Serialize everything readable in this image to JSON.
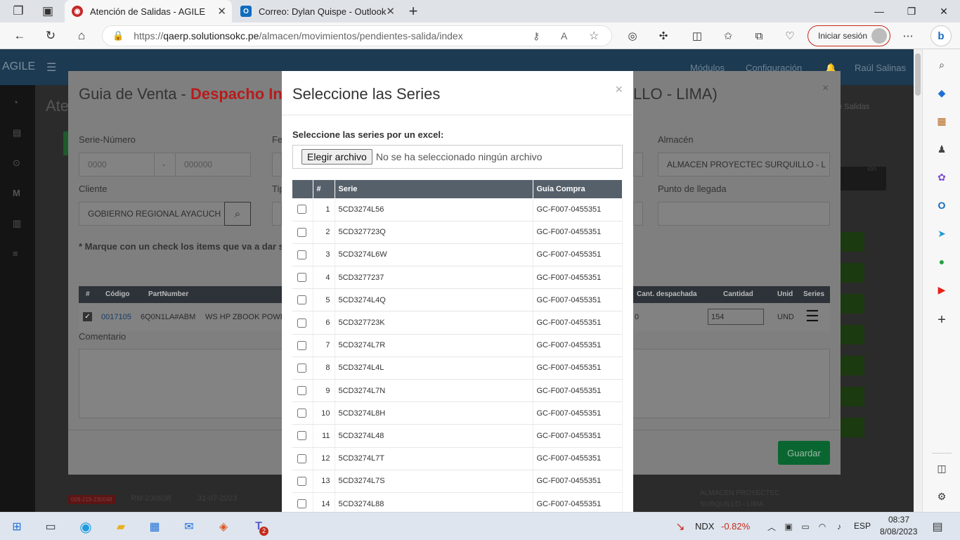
{
  "browser": {
    "tabs": [
      {
        "title": "Atención de Salidas - AGILE",
        "active": true
      },
      {
        "title": "Correo: Dylan Quispe - Outlook",
        "active": false
      }
    ],
    "url": {
      "scheme": "https://",
      "host": "qaerp.solutionsokc.pe",
      "path": "/almacen/movimientos/pendientes-salida/index"
    },
    "signin_label": "Iniciar sesión"
  },
  "app": {
    "logo": "AGILE",
    "nav": {
      "modules": "Módulos",
      "config": "Configuración",
      "user": "Raúl Salinas"
    },
    "bg_page_title": "Ate",
    "bg_breadcrumb": "Atención de Salidas",
    "bg_row": {
      "badge": "009-219-230048",
      "rm": "RM-230938",
      "date": "31-07-2023",
      "almacen": "ALMACEN PROYECTEC SURQUILLO - LIMA"
    }
  },
  "guide_modal": {
    "title_prefix": "Guia de Venta - ",
    "title_red": "Despacho Int",
    "title_suffix": "LLO - LIMA)",
    "serie_numero_label": "Serie-Número",
    "serie_value": "0000",
    "numero_value": "000000",
    "dash": "-",
    "fe_label": "Fe",
    "almacen_label": "Almacén",
    "almacen_value": "ALMACEN PROYECTEC SURQUILLO - L",
    "cliente_label": "Cliente",
    "cliente_value": "GOBIERNO REGIONAL AYACUCH",
    "tip_label": "Tip",
    "llegada_label": "Punto de llegada",
    "instruction": "* Marque con un check los items que va a dar sali",
    "table_headers": {
      "n": "#",
      "codigo": "Código",
      "part": "PartNumber",
      "despachada": "Cant. despachada",
      "cantidad": "Cantidad",
      "unid": "Unid",
      "series": "Series"
    },
    "item": {
      "codigo": "0017105",
      "part": "6Q0N1LA#ABM",
      "desc": "WS HP ZBOOK POWER",
      "despachada": "0",
      "cantidad": "154",
      "unid": "UND"
    },
    "comentario_label": "Comentario",
    "guardar_label": "Guardar"
  },
  "series_modal": {
    "title": "Seleccione las Series",
    "close": "×",
    "excel_label": "Seleccione las series por un excel:",
    "file_button": "Elegir archivo",
    "file_none": "No se ha seleccionado ningún archivo",
    "headers": {
      "n": "#",
      "serie": "Serie",
      "guia": "Guía Compra"
    },
    "rows": [
      {
        "n": "1",
        "serie": "5CD3274L56",
        "guia": "GC-F007-0455351"
      },
      {
        "n": "2",
        "serie": "5CD327723Q",
        "guia": "GC-F007-0455351"
      },
      {
        "n": "3",
        "serie": "5CD3274L6W",
        "guia": "GC-F007-0455351"
      },
      {
        "n": "4",
        "serie": "5CD3277237",
        "guia": "GC-F007-0455351"
      },
      {
        "n": "5",
        "serie": "5CD3274L4Q",
        "guia": "GC-F007-0455351"
      },
      {
        "n": "6",
        "serie": "5CD327723K",
        "guia": "GC-F007-0455351"
      },
      {
        "n": "7",
        "serie": "5CD3274L7R",
        "guia": "GC-F007-0455351"
      },
      {
        "n": "8",
        "serie": "5CD3274L4L",
        "guia": "GC-F007-0455351"
      },
      {
        "n": "9",
        "serie": "5CD3274L7N",
        "guia": "GC-F007-0455351"
      },
      {
        "n": "10",
        "serie": "5CD3274L8H",
        "guia": "GC-F007-0455351"
      },
      {
        "n": "11",
        "serie": "5CD3274L48",
        "guia": "GC-F007-0455351"
      },
      {
        "n": "12",
        "serie": "5CD3274L7T",
        "guia": "GC-F007-0455351"
      },
      {
        "n": "13",
        "serie": "5CD3274L7S",
        "guia": "GC-F007-0455351"
      },
      {
        "n": "14",
        "serie": "5CD3274L88",
        "guia": "GC-F007-0455351"
      }
    ]
  },
  "taskbar": {
    "ticker_name": "NDX",
    "ticker_change": "-0.82%",
    "lang": "ESP",
    "time": "08:37",
    "date": "8/08/2023",
    "teams_badge": "2"
  },
  "colors": {
    "accent_red": "#b71c1c",
    "save_green": "#0a6630",
    "header_dark": "#56606b",
    "signin_border": "#c42b1c"
  }
}
